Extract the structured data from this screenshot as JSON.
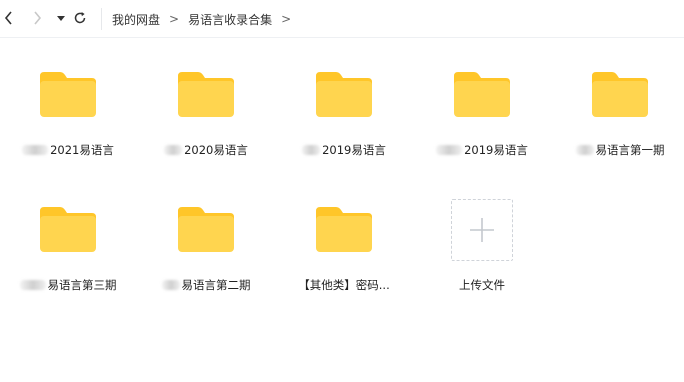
{
  "toolbar": {
    "back_icon": "chevron-left-icon",
    "forward_icon": "chevron-right-icon",
    "history_icon": "caret-down-icon",
    "refresh_icon": "refresh-icon"
  },
  "breadcrumb": {
    "items": [
      "我的网盘",
      "易语言收录合集"
    ],
    "separator": ">"
  },
  "folders": [
    {
      "name": "2021易语言",
      "icon": "folder-icon"
    },
    {
      "name": "2020易语言",
      "icon": "folder-icon"
    },
    {
      "name": "2019易语言",
      "icon": "folder-icon"
    },
    {
      "name": "2019易语言",
      "icon": "folder-icon"
    },
    {
      "name": "易语言第一期",
      "icon": "folder-icon"
    },
    {
      "name": "易语言第三期",
      "icon": "folder-icon"
    },
    {
      "name": "易语言第二期",
      "icon": "folder-icon"
    },
    {
      "name": "【其他类】密码...",
      "icon": "folder-icon"
    }
  ],
  "upload": {
    "label": "上传文件",
    "icon": "plus-icon"
  },
  "colors": {
    "folder_body": "#FFD54F",
    "folder_tab": "#FFC629",
    "border": "#eef0f3"
  }
}
